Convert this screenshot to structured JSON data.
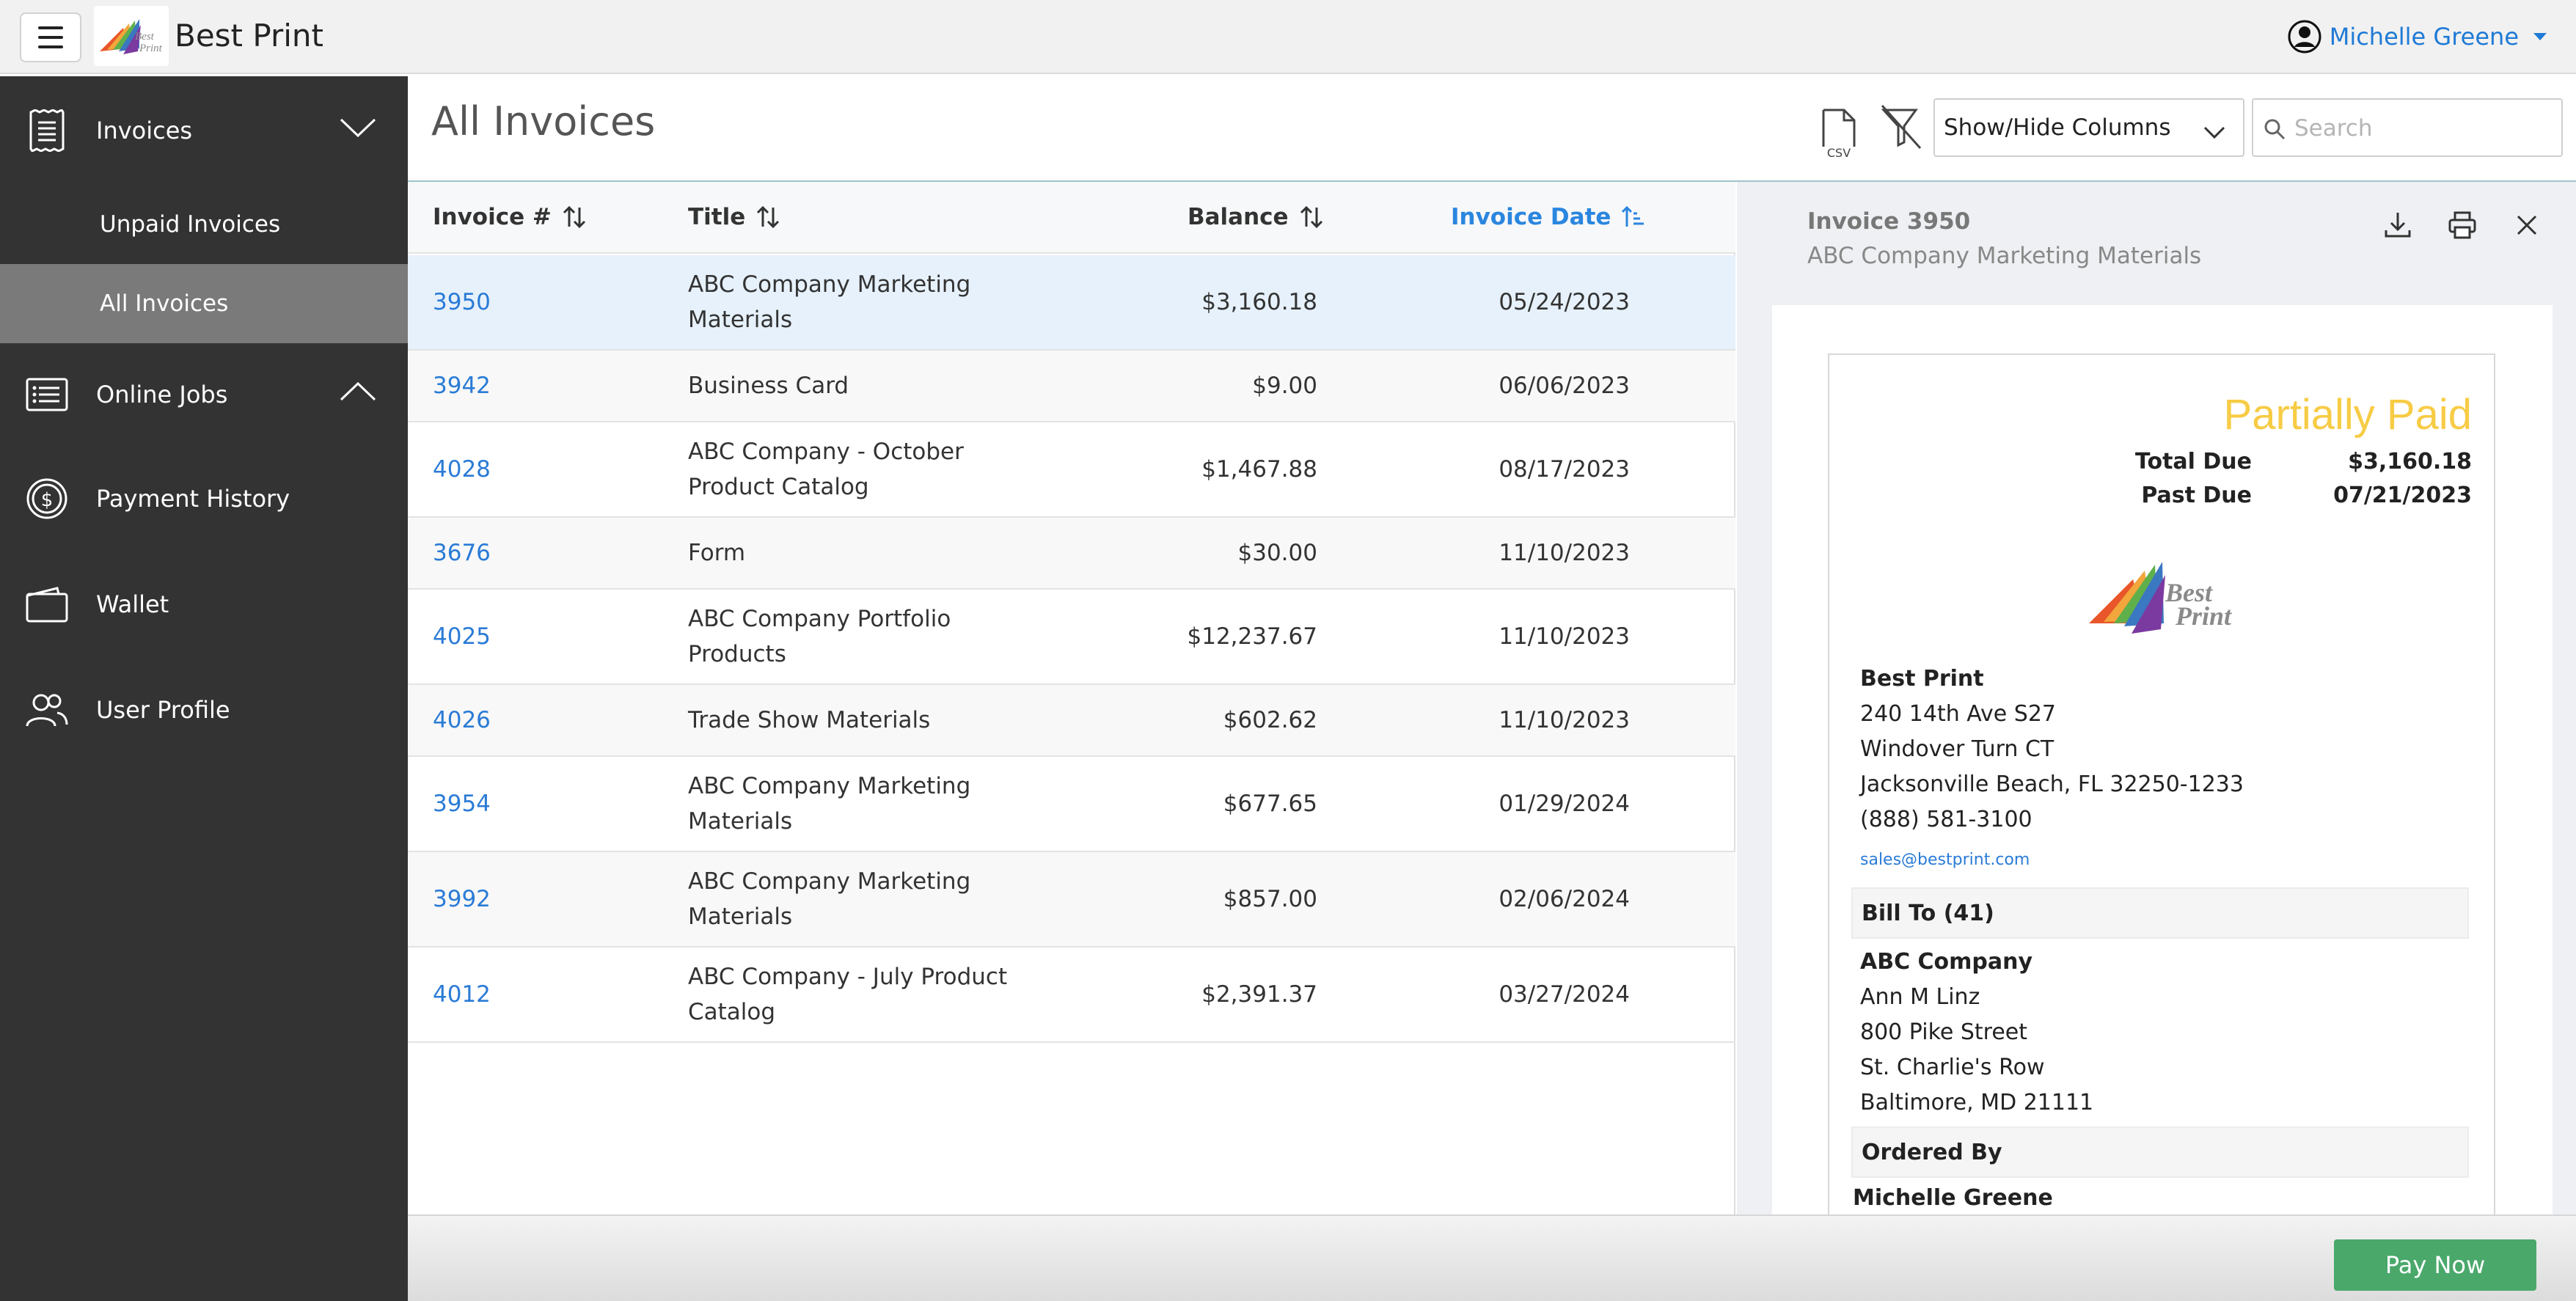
{
  "app": {
    "brand_name": "Best Print",
    "user_name": "Michelle Greene"
  },
  "sidebar": {
    "invoices_label": "Invoices",
    "unpaid_label": "Unpaid Invoices",
    "all_label": "All Invoices",
    "online_jobs_label": "Online Jobs",
    "payment_history_label": "Payment History",
    "wallet_label": "Wallet",
    "user_profile_label": "User Profile"
  },
  "toolbar": {
    "page_title": "All Invoices",
    "csv_label": "CSV",
    "columns_label": "Show/Hide Columns",
    "search_placeholder": "Search"
  },
  "table": {
    "headers": {
      "invoice": "Invoice #",
      "title": "Title",
      "balance": "Balance",
      "date": "Invoice Date"
    },
    "sorted_column": "Invoice Date",
    "rows": [
      {
        "invoice": "3950",
        "title": "ABC Company Marketing Materials",
        "balance": "$3,160.18",
        "date": "05/24/2023"
      },
      {
        "invoice": "3942",
        "title": "Business Card",
        "balance": "$9.00",
        "date": "06/06/2023"
      },
      {
        "invoice": "4028",
        "title": "ABC Company - October Product Catalog",
        "balance": "$1,467.88",
        "date": "08/17/2023"
      },
      {
        "invoice": "3676",
        "title": "Form",
        "balance": "$30.00",
        "date": "11/10/2023"
      },
      {
        "invoice": "4025",
        "title": "ABC Company Portfolio Products",
        "balance": "$12,237.67",
        "date": "11/10/2023"
      },
      {
        "invoice": "4026",
        "title": "Trade Show Materials",
        "balance": "$602.62",
        "date": "11/10/2023"
      },
      {
        "invoice": "3954",
        "title": "ABC Company Marketing Materials",
        "balance": "$677.65",
        "date": "01/29/2024"
      },
      {
        "invoice": "3992",
        "title": "ABC Company Marketing Materials",
        "balance": "$857.00",
        "date": "02/06/2024"
      },
      {
        "invoice": "4012",
        "title": "ABC Company - July Product Catalog",
        "balance": "$2,391.37",
        "date": "03/27/2024"
      }
    ]
  },
  "detail": {
    "heading": "Invoice 3950",
    "subheading": "ABC Company Marketing Materials",
    "status": "Partially Paid",
    "total_due_label": "Total Due",
    "total_due_value": "$3,160.18",
    "past_due_label": "Past Due",
    "past_due_value": "07/21/2023",
    "logo_text_line1": "Best",
    "logo_text_line2": "Print",
    "seller": {
      "name": "Best Print",
      "line1": "240 14th Ave S27",
      "line2": "Windover Turn CT",
      "line3": "Jacksonville Beach, FL 32250-1233",
      "phone": "(888) 581-3100",
      "email": "sales@bestprint.com"
    },
    "bill_to_label": "Bill To (41)",
    "bill_to": {
      "company": "ABC Company",
      "contact": "Ann M Linz",
      "line1": "800 Pike Street",
      "line2": "St. Charlie's Row",
      "line3": "Baltimore, MD 21111"
    },
    "ordered_by_label": "Ordered By",
    "ordered_by_name": "Michelle Greene"
  },
  "footer": {
    "pay_label": "Pay Now"
  },
  "colors": {
    "sidebar_bg": "#333333",
    "sidebar_active": "#7a7a7a",
    "link_blue": "#2a7bd6",
    "pay_green": "#4aa86b",
    "status_yellow": "#f7cc45",
    "selected_row": "#e6f1fb"
  },
  "icons": {
    "menu": "hamburger-icon",
    "user": "user-circle-icon",
    "invoices": "receipt-icon",
    "online_jobs": "list-icon",
    "payment_history": "dollar-circle-icon",
    "wallet": "wallet-icon",
    "user_profile": "users-icon",
    "csv": "csv-file-icon",
    "filter": "filter-off-icon",
    "search": "search-icon",
    "download": "download-icon",
    "print": "print-icon",
    "close": "close-icon"
  }
}
